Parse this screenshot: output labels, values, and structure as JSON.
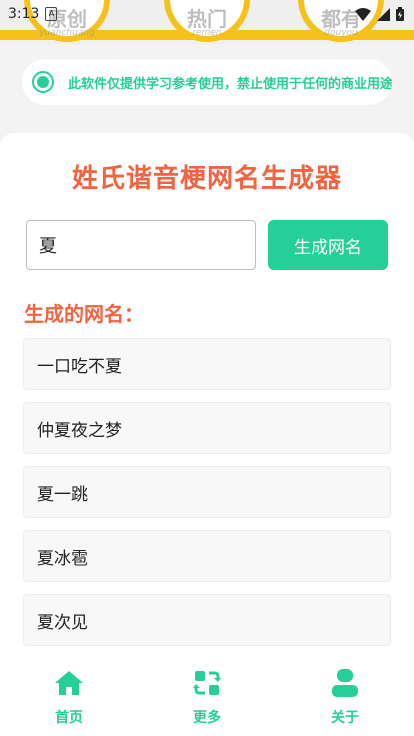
{
  "status_bar": {
    "time": "3:13"
  },
  "banner": {
    "coins": [
      {
        "main": "原创",
        "sub": "yuanchuang"
      },
      {
        "main": "热门",
        "sub": "remen"
      },
      {
        "main": "都有",
        "sub": "douyou"
      }
    ]
  },
  "notice": {
    "text": "此软件仅提供学习参考使用，禁止使用于任何的商业用途"
  },
  "page": {
    "title": "姓氏谐音梗网名生成器"
  },
  "form": {
    "input_value": "夏",
    "generate_label": "生成网名"
  },
  "results": {
    "heading": "生成的网名：",
    "items": [
      "一口吃不夏",
      "仲夏夜之梦",
      "夏一跳",
      "夏冰雹",
      "夏次见"
    ]
  },
  "nav": {
    "items": [
      {
        "label": "首页",
        "icon": "home-icon"
      },
      {
        "label": "更多",
        "icon": "refresh-icon"
      },
      {
        "label": "关于",
        "icon": "user-icon"
      }
    ]
  },
  "colors": {
    "accent": "#25cf98",
    "title": "#f2633f",
    "banner_ring": "#f6c21a"
  }
}
